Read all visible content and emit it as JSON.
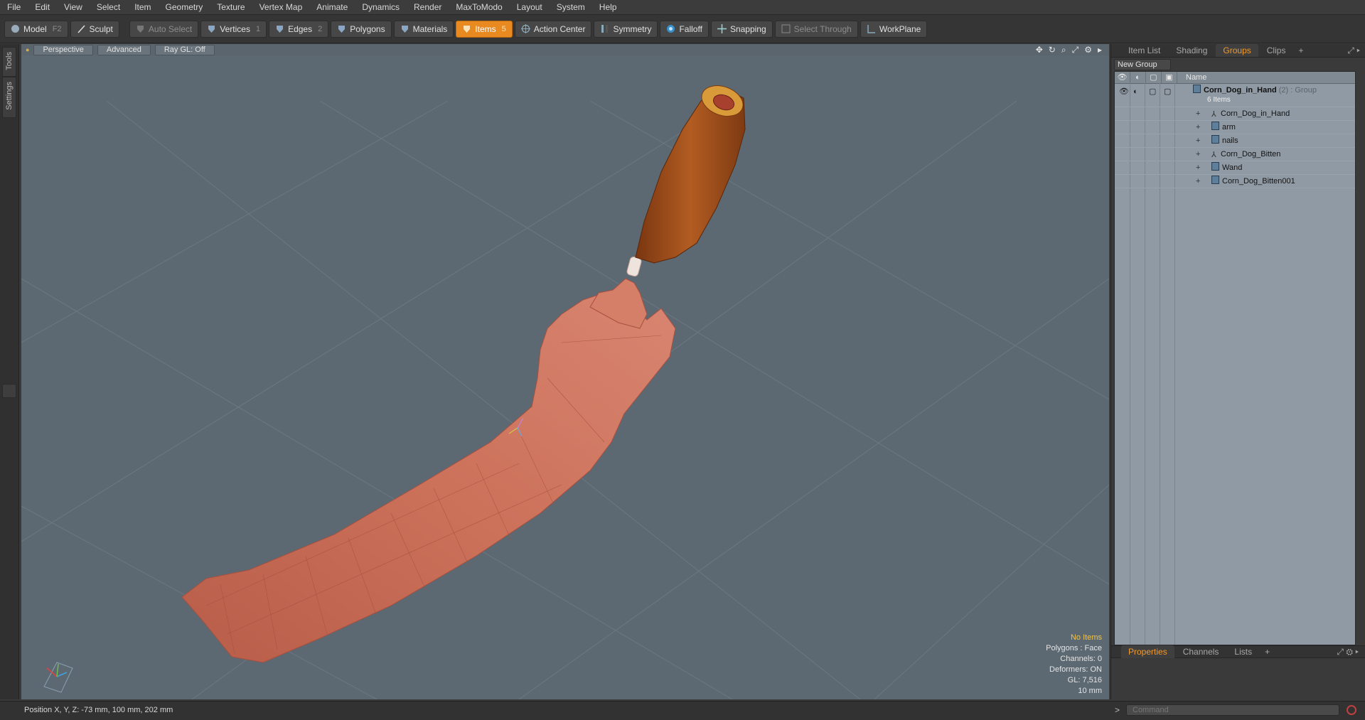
{
  "menu": [
    "File",
    "Edit",
    "View",
    "Select",
    "Item",
    "Geometry",
    "Texture",
    "Vertex Map",
    "Animate",
    "Dynamics",
    "Render",
    "MaxToModo",
    "Layout",
    "System",
    "Help"
  ],
  "toolbar": {
    "model": "Model",
    "model_key": "F2",
    "sculpt": "Sculpt",
    "auto_select": "Auto Select",
    "vertices": "Vertices",
    "vertices_key": "1",
    "edges": "Edges",
    "edges_key": "2",
    "polygons": "Polygons",
    "materials": "Materials",
    "items": "Items",
    "items_key": "5",
    "action_center": "Action Center",
    "symmetry": "Symmetry",
    "falloff": "Falloff",
    "snapping": "Snapping",
    "select_through": "Select Through",
    "workplane": "WorkPlane"
  },
  "left_tabs": [
    "Tools",
    "Settings"
  ],
  "viewport": {
    "perspective": "Perspective",
    "advanced": "Advanced",
    "raygl": "Ray GL: Off",
    "info": {
      "selection": "No Items",
      "polygons": "Polygons : Face",
      "channels": "Channels: 0",
      "deformers": "Deformers: ON",
      "gl": "GL: 7,516",
      "scale": "10 mm"
    },
    "colors": {
      "background": "#5d6972",
      "skin": "#c36b54",
      "corndog": "#9a4a18"
    }
  },
  "panel": {
    "tabs": [
      "Item List",
      "Shading",
      "Groups",
      "Clips"
    ],
    "active_tab": "Groups",
    "new_group": "New Group",
    "name_header": "Name",
    "group": {
      "name": "Corn_Dog_in_Hand",
      "count": "(2)",
      "type": ": Group",
      "items_label": "6 Items"
    },
    "items": [
      "Corn_Dog_in_Hand",
      "arm",
      "nails",
      "Corn_Dog_Bitten",
      "Wand",
      "Corn_Dog_Bitten001"
    ],
    "bottom_tabs": [
      "Properties",
      "Channels",
      "Lists"
    ],
    "bottom_active": "Properties"
  },
  "status": {
    "position": "Position X, Y, Z:  -73 mm, 100 mm, 202 mm",
    "command_placeholder": "Command",
    "prompt": ">"
  }
}
